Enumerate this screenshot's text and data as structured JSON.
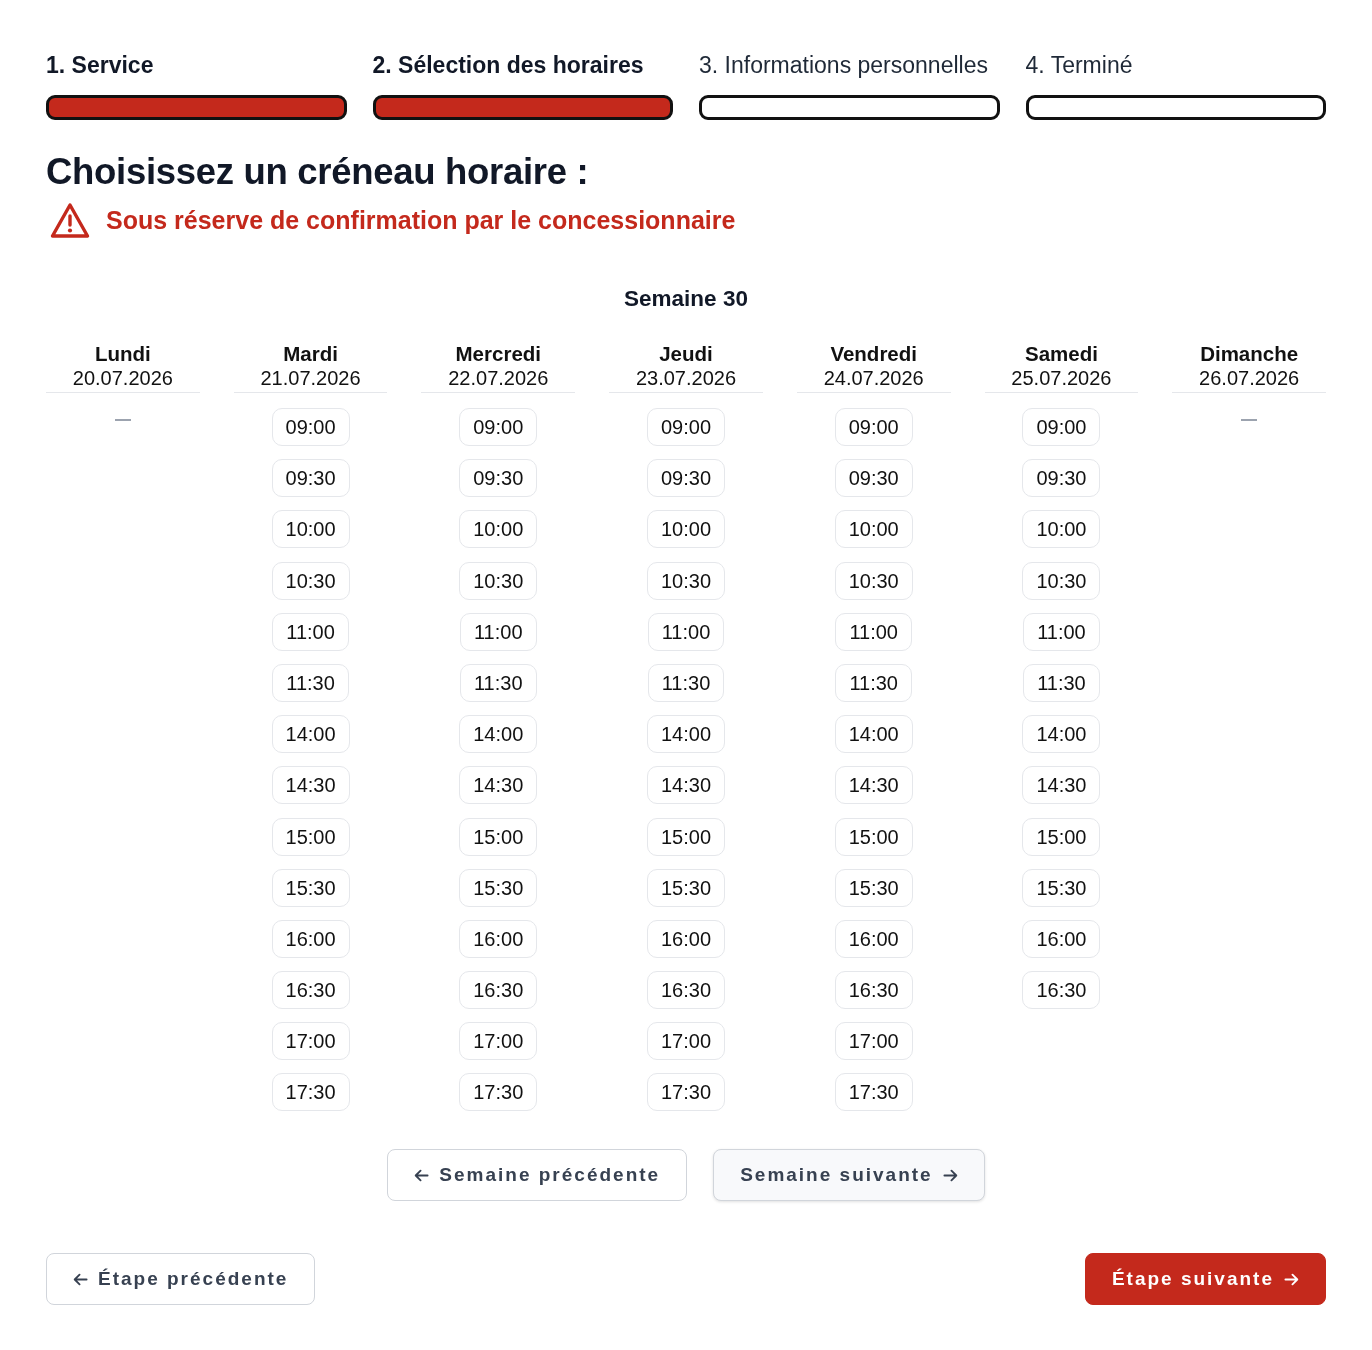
{
  "steps": [
    {
      "label": "1. Service",
      "completed": true
    },
    {
      "label": "2. Sélection des horaires",
      "completed": true
    },
    {
      "label": "3. Informations personnelles",
      "completed": false
    },
    {
      "label": "4. Terminé",
      "completed": false
    }
  ],
  "heading": "Choisissez un créneau horaire :",
  "warning": "Sous réserve de confirmation par le concessionnaire",
  "week": {
    "title": "Semaine 30",
    "days": [
      {
        "name": "Lundi",
        "date": "20.07.2026"
      },
      {
        "name": "Mardi",
        "date": "21.07.2026",
        "slots": [
          "09:00",
          "09:30",
          "10:00",
          "10:30",
          "11:00",
          "11:30",
          "14:00",
          "14:30",
          "15:00",
          "15:30",
          "16:00",
          "16:30",
          "17:00",
          "17:30"
        ]
      },
      {
        "name": "Mercredi",
        "date": "22.07.2026",
        "slots": [
          "09:00",
          "09:30",
          "10:00",
          "10:30",
          "11:00",
          "11:30",
          "14:00",
          "14:30",
          "15:00",
          "15:30",
          "16:00",
          "16:30",
          "17:00",
          "17:30"
        ]
      },
      {
        "name": "Jeudi",
        "date": "23.07.2026",
        "slots": [
          "09:00",
          "09:30",
          "10:00",
          "10:30",
          "11:00",
          "11:30",
          "14:00",
          "14:30",
          "15:00",
          "15:30",
          "16:00",
          "16:30",
          "17:00",
          "17:30"
        ]
      },
      {
        "name": "Vendredi",
        "date": "24.07.2026",
        "slots": [
          "09:00",
          "09:30",
          "10:00",
          "10:30",
          "11:00",
          "11:30",
          "14:00",
          "14:30",
          "15:00",
          "15:30",
          "16:00",
          "16:30",
          "17:00",
          "17:30"
        ]
      },
      {
        "name": "Samedi",
        "date": "25.07.2026",
        "slots": [
          "09:00",
          "09:30",
          "10:00",
          "10:30",
          "11:00",
          "11:30",
          "14:00",
          "14:30",
          "15:00",
          "15:30",
          "16:00",
          "16:30"
        ]
      },
      {
        "name": "Dimanche",
        "date": "26.07.2026"
      }
    ]
  },
  "week_buttons": [
    {
      "label": "Semaine précédente",
      "kind": "back",
      "highlighted": false
    },
    {
      "label": "Semaine suivante",
      "kind": "forward",
      "highlighted": true
    }
  ],
  "step_buttons": [
    {
      "label": "Étape précédente",
      "kind": "back",
      "primary": false
    },
    {
      "label": "Étape suivante",
      "kind": "forward",
      "primary": true
    }
  ]
}
